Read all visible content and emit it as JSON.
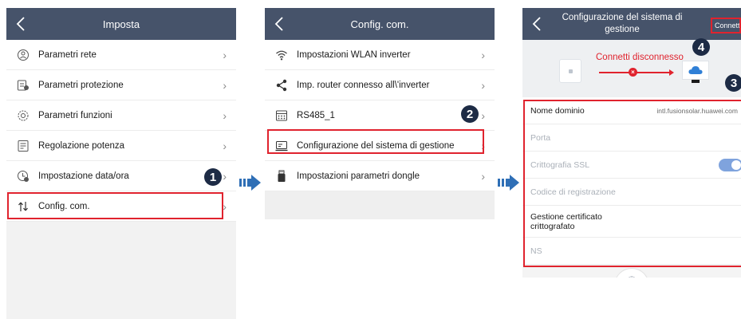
{
  "screen1": {
    "title": "Imposta",
    "items": [
      {
        "label": "Parametri rete",
        "icon": "network-params-icon"
      },
      {
        "label": "Parametri protezione",
        "icon": "protection-params-icon"
      },
      {
        "label": "Parametri funzioni",
        "icon": "function-params-icon"
      },
      {
        "label": "Regolazione potenza",
        "icon": "power-adjust-icon"
      },
      {
        "label": "Impostazione data/ora",
        "icon": "clock-icon"
      },
      {
        "label": "Config. com.",
        "icon": "transfer-arrows-icon"
      }
    ],
    "badge": "1"
  },
  "screen2": {
    "title": "Config. com.",
    "items": [
      {
        "label": "Impostazioni WLAN inverter",
        "icon": "wifi-icon"
      },
      {
        "label": "Imp. router connesso all\\'inverter",
        "icon": "share-icon"
      },
      {
        "label": "RS485_1",
        "icon": "rs485-icon"
      },
      {
        "label": "Configurazione del sistema di gestione",
        "icon": "management-system-icon"
      },
      {
        "label": "Impostazioni parametri dongle",
        "icon": "dongle-icon"
      }
    ],
    "badge": "2"
  },
  "screen3": {
    "title_line1": "Configurazione del sistema di",
    "title_line2": "gestione",
    "connect_label": "Connetti",
    "status_text": "Connetti disconnesso",
    "fields": [
      {
        "label": "Nome dominio",
        "value": "intl.fusionsolar.huawei.com",
        "dim": false
      },
      {
        "label": "Porta",
        "value": "",
        "dim": true
      },
      {
        "label": "Crittografia SSL",
        "value": "",
        "dim": true,
        "toggle": true
      },
      {
        "label": "Codice di registrazione",
        "value": "",
        "dim": true
      },
      {
        "label": "Gestione certificato crittografato",
        "value": "",
        "dim": false
      },
      {
        "label": "NS",
        "value": "",
        "dim": true
      }
    ],
    "badge_fields": "3",
    "badge_connect": "4"
  },
  "colors": {
    "topbar": "#46536a",
    "highlight": "#e0232e",
    "badge": "#1d2b45",
    "arrow": "#2f6fb6",
    "toggle": "#7fa3dd"
  }
}
